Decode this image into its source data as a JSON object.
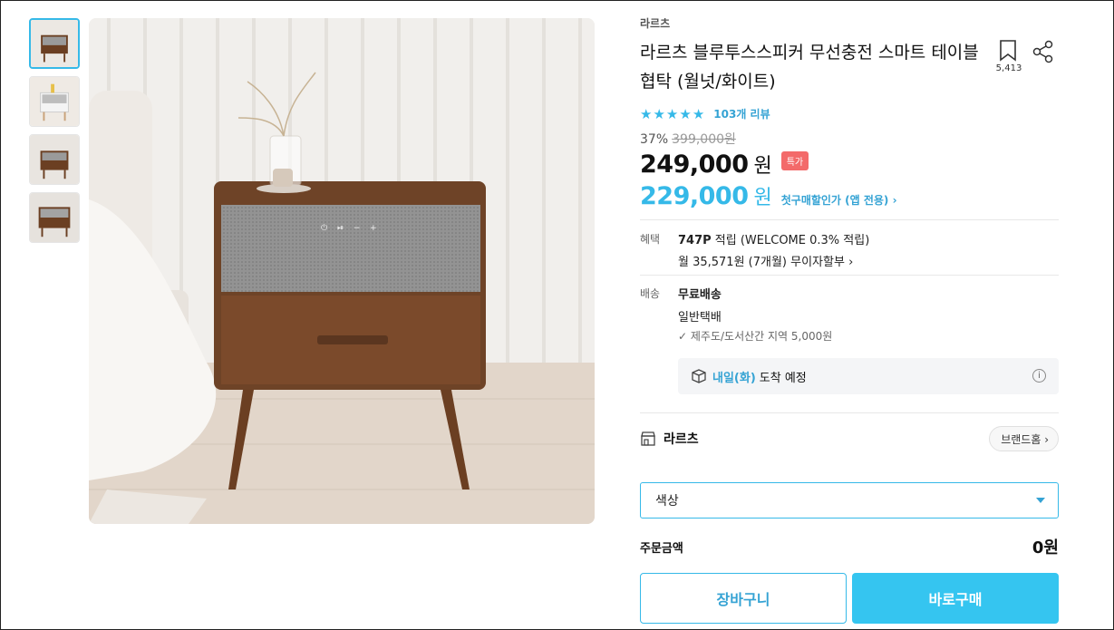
{
  "product": {
    "brand": "라르츠",
    "title": "라르츠 블루투스스피커 무선충전 스마트 테이블 협탁 (월넛/화이트)",
    "bookmark_count": "5,413",
    "rating_stars": 5,
    "review_count": "103개 리뷰",
    "discount_rate": "37%",
    "original_price": "399,000원",
    "price": "249,000",
    "price_unit": "원",
    "special_badge": "특가",
    "first_purchase_price": "229,000",
    "first_purchase_unit": "원",
    "first_purchase_label": "첫구매할인가 (앱 전용) ›"
  },
  "benefits": {
    "label": "혜택",
    "points_bold": "747P",
    "points_text": " 적립 (WELCOME 0.3% 적립)",
    "installment": "월 35,571원 (7개월) 무이자할부 ›"
  },
  "shipping": {
    "label": "배송",
    "type": "무료배송",
    "method": "일반택배",
    "extra": "✓  제주도/도서산간 지역 5,000원",
    "arrival_day": "내일(화)",
    "arrival_text": "도착 예정"
  },
  "store": {
    "name": "라르츠",
    "home_button": "브랜드홈 ›"
  },
  "option": {
    "color_placeholder": "색상"
  },
  "order": {
    "total_label": "주문금액",
    "total_value": "0원"
  },
  "buttons": {
    "cart": "장바구니",
    "buy": "바로구매"
  },
  "colors": {
    "accent": "#35c5f0",
    "badge": "#f36a6a"
  }
}
